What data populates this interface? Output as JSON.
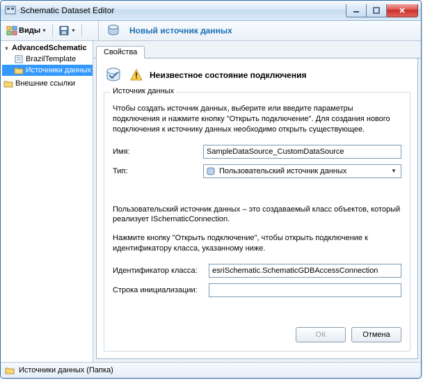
{
  "window": {
    "title": "Schematic Dataset Editor"
  },
  "toolbar": {
    "views_label": "Виды",
    "new_source_link": "Новый источник данных"
  },
  "tree": {
    "root": "AdvancedSchematic",
    "items": [
      {
        "label": "BrazilTemplate"
      },
      {
        "label": "Источники данных"
      }
    ],
    "external": "Внешние ссылки"
  },
  "tab": {
    "properties": "Свойства"
  },
  "alert": {
    "text": "Неизвестное состояние подключения"
  },
  "group": {
    "title": "Источник данных",
    "description": "Чтобы создать источник данных, выберите или введите параметры подключения и нажмите кнопку \"Открыть подключение\". Для создания нового подключения к источнику данных необходимо открыть существующее.",
    "name_label": "Имя:",
    "name_value": "SampleDataSource_CustomDataSource",
    "type_label": "Тип:",
    "type_value": "Пользовательский источник данных",
    "custom_desc": "Пользовательский источник данных – это создаваемый класс объектов, который реализует ISchematicConnection.",
    "open_desc": "Нажмите кнопку \"Открыть подключение\", чтобы открыть подключение к идентификатору класса, указанному ниже.",
    "classid_label": "Идентификатор класса:",
    "classid_value": "esriSchematic.SchematicGDBAccessConnection",
    "init_label": "Строка инициализации:",
    "init_value": ""
  },
  "buttons": {
    "ok": "ОК",
    "cancel": "Отмена"
  },
  "status": {
    "text": "Источники данных (Папка)"
  }
}
